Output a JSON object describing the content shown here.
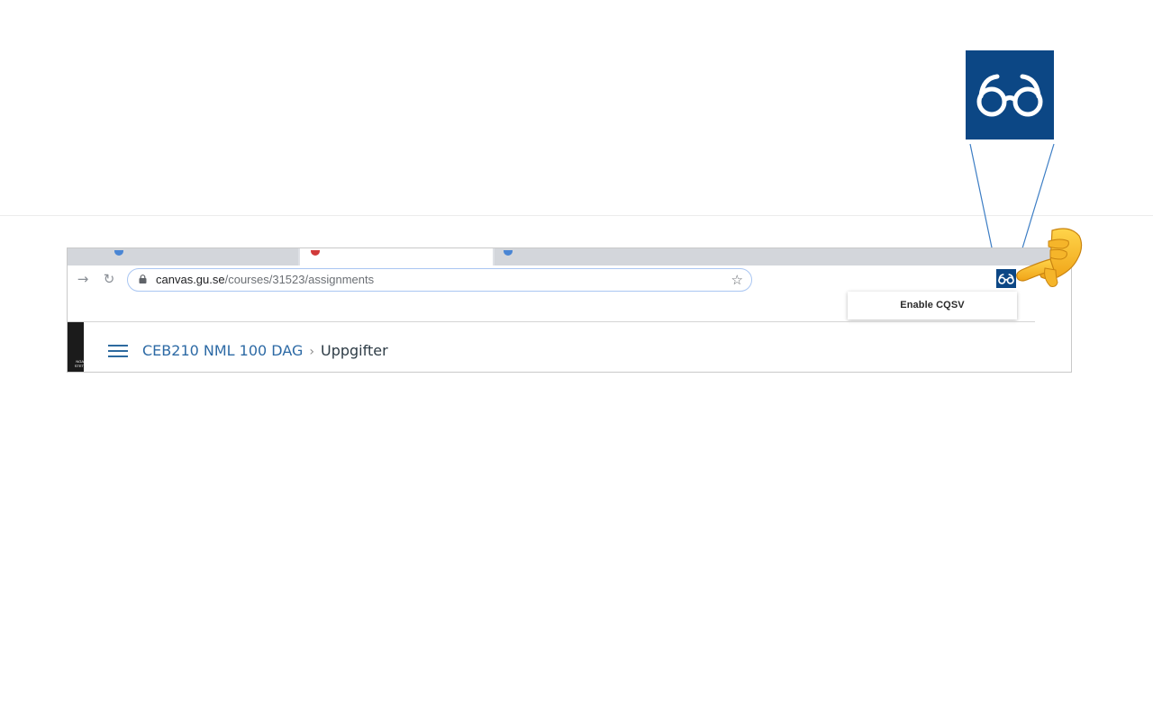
{
  "browser": {
    "url": {
      "host": "canvas.gu.se",
      "path": "/courses/31523/assignments"
    }
  },
  "extension": {
    "icon": "glasses-icon",
    "color": "#0c4785",
    "menu": {
      "items": [
        {
          "label": "Enable CQSV"
        }
      ]
    }
  },
  "canvas": {
    "breadcrumb": {
      "course": "CEB210 NML 100 DAG",
      "separator": "›",
      "current": "Uppgifter"
    },
    "accent": "#2d6aa5"
  },
  "annotation": {
    "pointer": "pointing-hand-icon"
  }
}
